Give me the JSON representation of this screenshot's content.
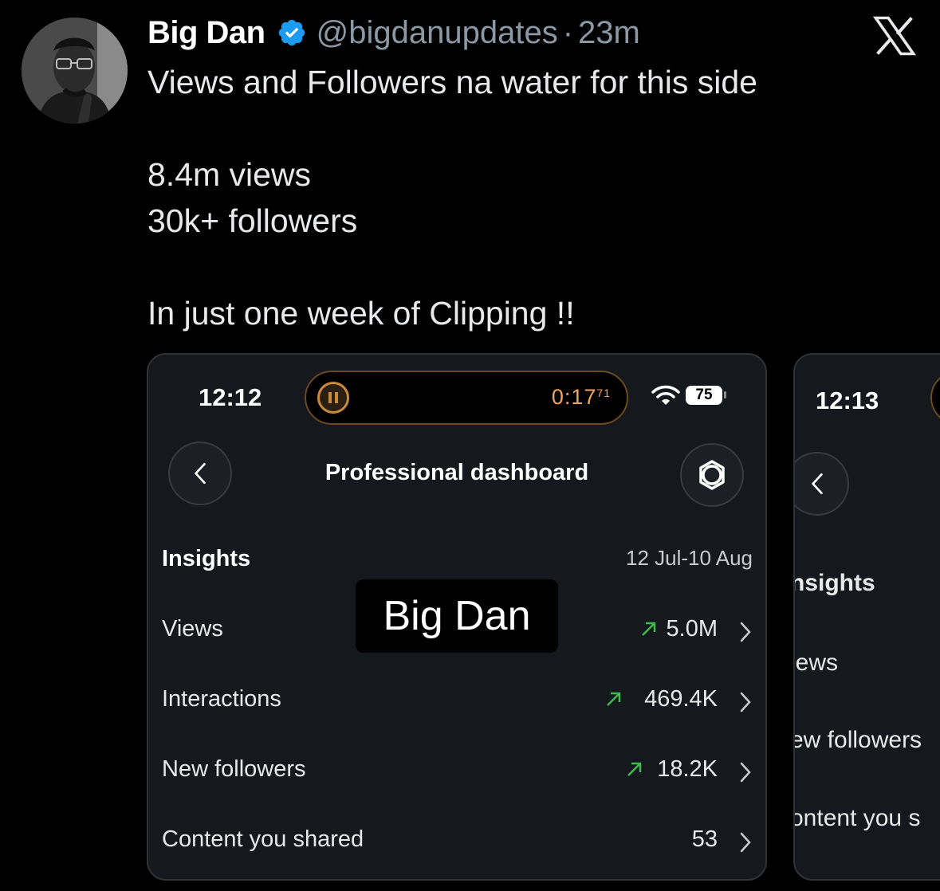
{
  "tweet": {
    "author_name": "Big Dan",
    "handle": "@bigdanupdates",
    "separator": "·",
    "time": "23m",
    "verified_icon": "verified-badge-icon",
    "brand_icon": "x-logo-icon",
    "text": "Views and Followers na water for this side\n\n8.4m views\n30k+ followers\n\nIn just one week of Clipping !!"
  },
  "screenshot1": {
    "status_time": "12:12",
    "timer": "0:17",
    "timer_fraction": "71",
    "battery": "75",
    "page_title": "Professional dashboard",
    "section_title": "Insights",
    "date_range": "12 Jul-10 Aug",
    "watermark": "Big Dan",
    "rows": [
      {
        "label": "Views",
        "value": "5.0M",
        "trend": "up"
      },
      {
        "label": "Interactions",
        "value": "469.4K",
        "trend": "up"
      },
      {
        "label": "New followers",
        "value": "18.2K",
        "trend": "up"
      },
      {
        "label": "Content you shared",
        "value": "53",
        "trend": "none"
      }
    ],
    "colors": {
      "trend_up": "#3fb950",
      "timer": "#f2a65a"
    }
  },
  "screenshot2": {
    "status_time": "12:13",
    "section_title": "nsights",
    "rows": [
      "iews",
      "ew followers",
      "ontent you s"
    ]
  }
}
